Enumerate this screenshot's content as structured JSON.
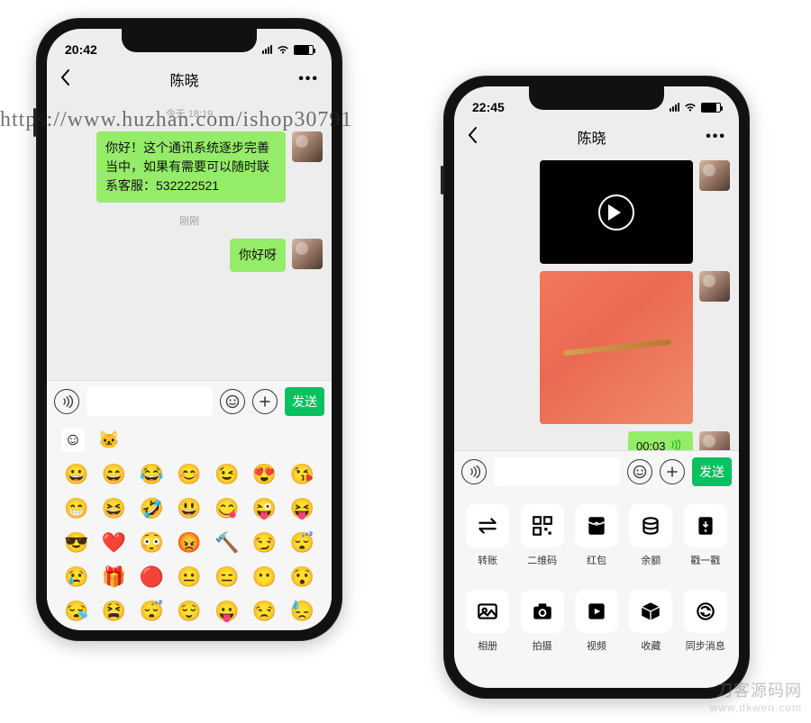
{
  "watermark_url": "https://www.huzhan.com/ishop30791",
  "watermark_site_cn": "刀客源码网",
  "watermark_site_en": "www.dkwen.com",
  "phone1": {
    "time": "20:42",
    "contact_name": "陈晓",
    "ts1": "今天 18:19",
    "msg1": "你好！这个通讯系统逐步完善当中，如果有需要可以随时联系客服：532222521",
    "ts2": "刚刚",
    "msg2": "你好呀",
    "send_label": "发送",
    "emojis": [
      "😀",
      "😄",
      "😂",
      "😊",
      "😉",
      "😍",
      "😘",
      "😁",
      "😆",
      "🤣",
      "😃",
      "😋",
      "😜",
      "😝",
      "😎",
      "❤️",
      "😳",
      "😡",
      "🔨",
      "😏",
      "😴",
      "😢",
      "🎁",
      "🔴",
      "😐",
      "😑",
      "😶",
      "😯",
      "😪",
      "😫",
      "😴",
      "😌",
      "😛",
      "😒",
      "😓"
    ]
  },
  "phone2": {
    "time": "22:45",
    "contact_name": "陈晓",
    "audio_label": "00:03",
    "send_label": "发送",
    "actions": [
      {
        "label": "转账",
        "icon": "transfer"
      },
      {
        "label": "二维码",
        "icon": "qrcode"
      },
      {
        "label": "红包",
        "icon": "redpacket"
      },
      {
        "label": "余额",
        "icon": "coins"
      },
      {
        "label": "戳一戳",
        "icon": "tap"
      },
      {
        "label": "相册",
        "icon": "album"
      },
      {
        "label": "拍摄",
        "icon": "camera"
      },
      {
        "label": "视频",
        "icon": "video"
      },
      {
        "label": "收藏",
        "icon": "box"
      },
      {
        "label": "同步消息",
        "icon": "sync"
      }
    ]
  }
}
